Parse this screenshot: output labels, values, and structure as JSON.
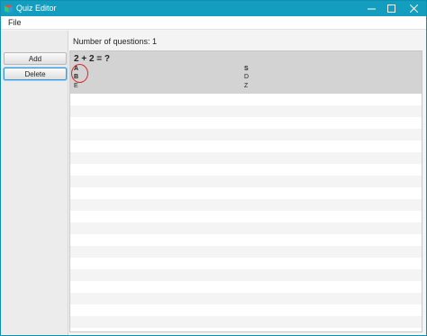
{
  "window": {
    "title": "Quiz Editor",
    "accent_color": "#139ebf",
    "app_icon": "quiz-app-icon",
    "controls": {
      "minimize_icon": "minimize-icon",
      "maximize_icon": "maximize-icon",
      "close_icon": "close-icon"
    }
  },
  "menubar": {
    "items": [
      {
        "label": "File"
      }
    ]
  },
  "sidebar": {
    "add_label": "Add",
    "delete_label": "Delete"
  },
  "main": {
    "count_label": "Number of questions: 1",
    "questions": [
      {
        "text": "2 + 2 = ?",
        "answers_left": [
          "A",
          "B",
          "E"
        ],
        "answers_right": [
          "S",
          "D",
          "Z"
        ],
        "selected": true
      }
    ],
    "annotation_color": "#d8242b"
  }
}
